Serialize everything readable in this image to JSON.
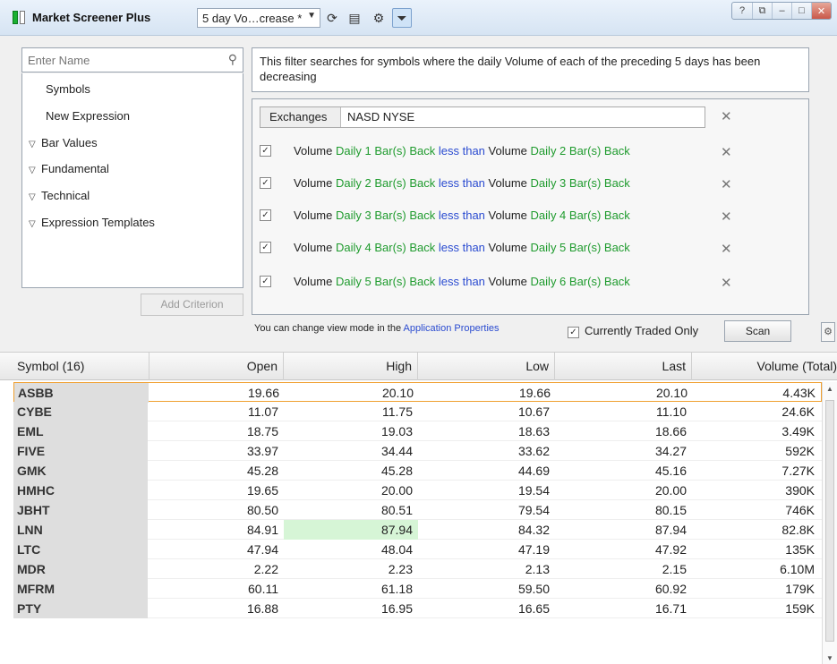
{
  "app": {
    "title": "Market Screener Plus",
    "preset": "5 day Vo…crease *",
    "window_controls": [
      "?",
      "⧉",
      "–",
      "□",
      "✕"
    ]
  },
  "left": {
    "search_placeholder": "Enter Name",
    "tree": [
      {
        "label": "Symbols",
        "group": false
      },
      {
        "label": "New Expression",
        "group": false
      },
      {
        "label": "Bar Values",
        "group": true
      },
      {
        "label": "Fundamental",
        "group": true
      },
      {
        "label": "Technical",
        "group": true
      },
      {
        "label": "Expression Templates",
        "group": true
      }
    ],
    "add_criterion": "Add Criterion"
  },
  "right": {
    "description": "This filter searches for symbols where the daily Volume of each of the preceding 5 days has been decreasing",
    "exchanges_label": "Exchanges",
    "exchanges_value": "NASD NYSE",
    "criteria": [
      {
        "field": "Volume",
        "left": "Daily 1 Bar(s) Back",
        "op": "less than",
        "field2": "Volume",
        "right": "Daily 2 Bar(s) Back"
      },
      {
        "field": "Volume",
        "left": "Daily 2 Bar(s) Back",
        "op": "less than",
        "field2": "Volume",
        "right": "Daily 3 Bar(s) Back"
      },
      {
        "field": "Volume",
        "left": "Daily 3 Bar(s) Back",
        "op": "less than",
        "field2": "Volume",
        "right": "Daily 4 Bar(s) Back"
      },
      {
        "field": "Volume",
        "left": "Daily 4 Bar(s) Back",
        "op": "less than",
        "field2": "Volume",
        "right": "Daily 5 Bar(s) Back"
      },
      {
        "field": "Volume",
        "left": "Daily 5 Bar(s) Back",
        "op": "less than",
        "field2": "Volume",
        "right": "Daily 6 Bar(s) Back"
      }
    ],
    "hint_text": "You can change view mode in the ",
    "hint_link": "Application Properties",
    "currently_traded": "Currently Traded Only",
    "scan": "Scan"
  },
  "grid": {
    "headers": [
      "Symbol (16)",
      "Open",
      "High",
      "Low",
      "Last",
      "Volume (Total)"
    ],
    "rows": [
      [
        "ASBB",
        "19.66",
        "20.10",
        "19.66",
        "20.10",
        "4.43K"
      ],
      [
        "CYBE",
        "11.07",
        "11.75",
        "10.67",
        "11.10",
        "24.6K"
      ],
      [
        "EML",
        "18.75",
        "19.03",
        "18.63",
        "18.66",
        "3.49K"
      ],
      [
        "FIVE",
        "33.97",
        "34.44",
        "33.62",
        "34.27",
        "592K"
      ],
      [
        "GMK",
        "45.28",
        "45.28",
        "44.69",
        "45.16",
        "7.27K"
      ],
      [
        "HMHC",
        "19.65",
        "20.00",
        "19.54",
        "20.00",
        "390K"
      ],
      [
        "JBHT",
        "80.50",
        "80.51",
        "79.54",
        "80.15",
        "746K"
      ],
      [
        "LNN",
        "84.91",
        "87.94",
        "84.32",
        "87.94",
        "82.8K"
      ],
      [
        "LTC",
        "47.94",
        "48.04",
        "47.19",
        "47.92",
        "135K"
      ],
      [
        "MDR",
        "2.22",
        "2.23",
        "2.13",
        "2.15",
        "6.10M"
      ],
      [
        "MFRM",
        "60.11",
        "61.18",
        "59.50",
        "60.92",
        "179K"
      ],
      [
        "PTY",
        "16.88",
        "16.95",
        "16.65",
        "16.71",
        "159K"
      ]
    ]
  },
  "colors": {
    "accent_green": "#1f9b2e",
    "accent_blue": "#2a4bd0",
    "highlight_cell": "#d6f5d6",
    "selected_border": "#f0a030"
  }
}
